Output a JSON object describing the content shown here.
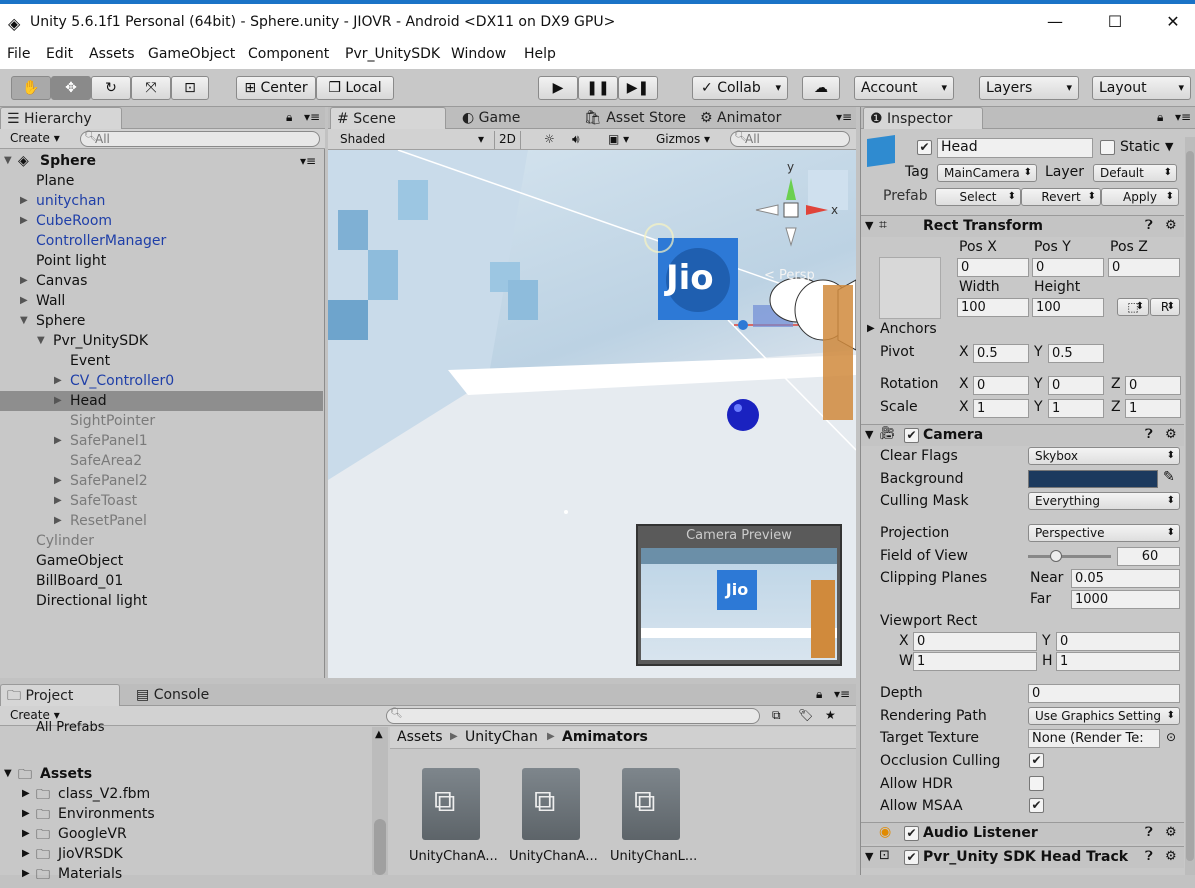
{
  "window": {
    "title": "Unity 5.6.1f1 Personal (64bit) - Sphere.unity - JIOVR - Android <DX11 on DX9 GPU>",
    "minimize": "—",
    "maximize": "☐",
    "close": "✕"
  },
  "menu": [
    "File",
    "Edit",
    "Assets",
    "GameObject",
    "Component",
    "Pvr_UnitySDK",
    "Window",
    "Help"
  ],
  "toolbar": {
    "pivot": "Center",
    "space": "Local",
    "collab": "Collab",
    "account": "Account",
    "layers": "Layers",
    "layout": "Layout"
  },
  "hierarchy": {
    "tab": "Hierarchy",
    "create": "Create",
    "search_placeholder": "All",
    "scene": "Sphere",
    "items": [
      {
        "label": "Plane",
        "indent": 0,
        "arrow": false,
        "color": "normal"
      },
      {
        "label": "unitychan",
        "indent": 0,
        "arrow": true,
        "color": "blue"
      },
      {
        "label": "CubeRoom",
        "indent": 0,
        "arrow": true,
        "color": "blue"
      },
      {
        "label": "ControllerManager",
        "indent": 0,
        "arrow": false,
        "color": "blue"
      },
      {
        "label": "Point light",
        "indent": 0,
        "arrow": false,
        "color": "normal"
      },
      {
        "label": "Canvas",
        "indent": 0,
        "arrow": true,
        "color": "normal"
      },
      {
        "label": "Wall",
        "indent": 0,
        "arrow": true,
        "color": "normal"
      },
      {
        "label": "Sphere",
        "indent": 0,
        "arrow": "open",
        "color": "normal"
      },
      {
        "label": "Pvr_UnitySDK",
        "indent": 1,
        "arrow": "open",
        "color": "normal"
      },
      {
        "label": "Event",
        "indent": 2,
        "arrow": false,
        "color": "normal"
      },
      {
        "label": "CV_Controller0",
        "indent": 2,
        "arrow": true,
        "color": "blue"
      },
      {
        "label": "Head",
        "indent": 2,
        "arrow": true,
        "color": "normal",
        "selected": true
      },
      {
        "label": "SightPointer",
        "indent": 2,
        "arrow": false,
        "color": "grey"
      },
      {
        "label": "SafePanel1",
        "indent": 2,
        "arrow": true,
        "color": "grey"
      },
      {
        "label": "SafeArea2",
        "indent": 2,
        "arrow": false,
        "color": "grey"
      },
      {
        "label": "SafePanel2",
        "indent": 2,
        "arrow": true,
        "color": "grey"
      },
      {
        "label": "SafeToast",
        "indent": 2,
        "arrow": true,
        "color": "grey"
      },
      {
        "label": "ResetPanel",
        "indent": 2,
        "arrow": true,
        "color": "grey"
      },
      {
        "label": "Cylinder",
        "indent": 0,
        "arrow": false,
        "color": "grey"
      },
      {
        "label": "GameObject",
        "indent": 0,
        "arrow": false,
        "color": "normal"
      },
      {
        "label": "BillBoard_01",
        "indent": 0,
        "arrow": false,
        "color": "normal"
      },
      {
        "label": "Directional light",
        "indent": 0,
        "arrow": false,
        "color": "normal"
      }
    ]
  },
  "scene": {
    "tabs": [
      "Scene",
      "Game",
      "Asset Store",
      "Animator"
    ],
    "shading": "Shaded",
    "mode2d": "2D",
    "gizmos": "Gizmos",
    "search_placeholder": "All",
    "persp": "Persp",
    "jio": "Jio",
    "axis_y": "y",
    "axis_x": "x",
    "preview_title": "Camera Preview"
  },
  "inspector": {
    "tab": "Inspector",
    "name": "Head",
    "static": "Static",
    "tag_label": "Tag",
    "tag": "MainCamera",
    "layer_label": "Layer",
    "layer": "Default",
    "prefab_label": "Prefab",
    "select": "Select",
    "revert": "Revert",
    "apply": "Apply",
    "rect": {
      "title": "Rect Transform",
      "posx_l": "Pos X",
      "posy_l": "Pos Y",
      "posz_l": "Pos Z",
      "posx": "0",
      "posy": "0",
      "posz": "0",
      "width_l": "Width",
      "height_l": "Height",
      "width": "100",
      "height": "100",
      "r": "R",
      "anchors": "Anchors",
      "pivot": "Pivot",
      "pivot_x": "0.5",
      "pivot_y": "0.5",
      "rotation": "Rotation",
      "rot_x": "0",
      "rot_y": "0",
      "rot_z": "0",
      "scale": "Scale",
      "sc_x": "1",
      "sc_y": "1",
      "sc_z": "1",
      "x": "X",
      "y": "Y",
      "z": "Z"
    },
    "camera": {
      "title": "Camera",
      "clear_flags_l": "Clear Flags",
      "clear_flags": "Skybox",
      "background_l": "Background",
      "culling_l": "Culling Mask",
      "culling": "Everything",
      "projection_l": "Projection",
      "projection": "Perspective",
      "fov_l": "Field of View",
      "fov": "60",
      "fov_value": 60,
      "clip_l": "Clipping Planes",
      "near_l": "Near",
      "near": "0.05",
      "far_l": "Far",
      "far": "1000",
      "viewport_l": "Viewport Rect",
      "vx": "0",
      "vy": "0",
      "vw": "1",
      "vh": "1",
      "w": "W",
      "h": "H",
      "depth_l": "Depth",
      "depth": "0",
      "render_l": "Rendering Path",
      "render": "Use Graphics Setting",
      "target_l": "Target Texture",
      "target": "None (Render Te:",
      "occl_l": "Occlusion Culling",
      "hdr_l": "Allow HDR",
      "msaa_l": "Allow MSAA",
      "check": "✔",
      "bgcolor": "#1c3a5e"
    },
    "audio": "Audio Listener",
    "pvr": "Pvr_Unity SDK Head Track"
  },
  "project": {
    "tabs": [
      "Project",
      "Console"
    ],
    "create": "Create",
    "all_prefabs": "All Prefabs",
    "assets": "Assets",
    "folders": [
      "class_V2.fbm",
      "Environments",
      "GoogleVR",
      "JioVRSDK",
      "Materials"
    ],
    "breadcrumb": [
      "Assets",
      "UnityChan",
      "Amimators"
    ],
    "files": [
      "UnityChanA...",
      "UnityChanA...",
      "UnityChanL..."
    ]
  }
}
